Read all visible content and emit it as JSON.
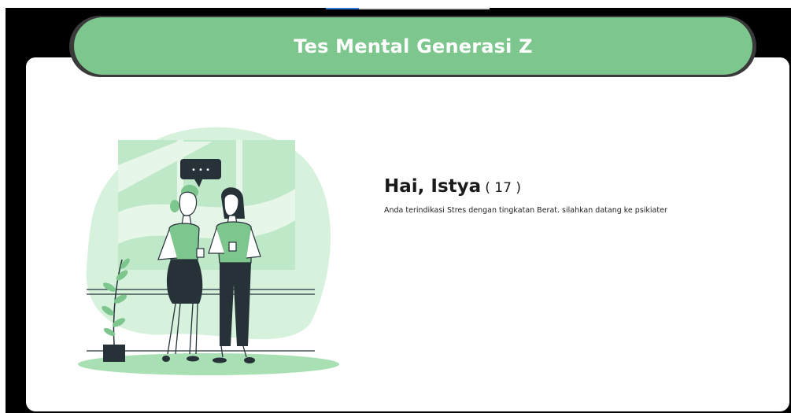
{
  "header": {
    "title": "Tes Mental Generasi Z"
  },
  "result": {
    "greeting": "Hai, Istya",
    "age": "( 17 )",
    "message": "Anda terindikasi Stres dengan tingkatan Berat. silahkan datang ke psikiater"
  },
  "illustration": {
    "name": "two-women-talking-illustration",
    "speech_bubble_text": "• • •"
  },
  "colors": {
    "banner": "#7dc68e",
    "accent_light": "#d6f2dc",
    "accent_mid": "#a8e0b3",
    "dark": "#263238"
  }
}
